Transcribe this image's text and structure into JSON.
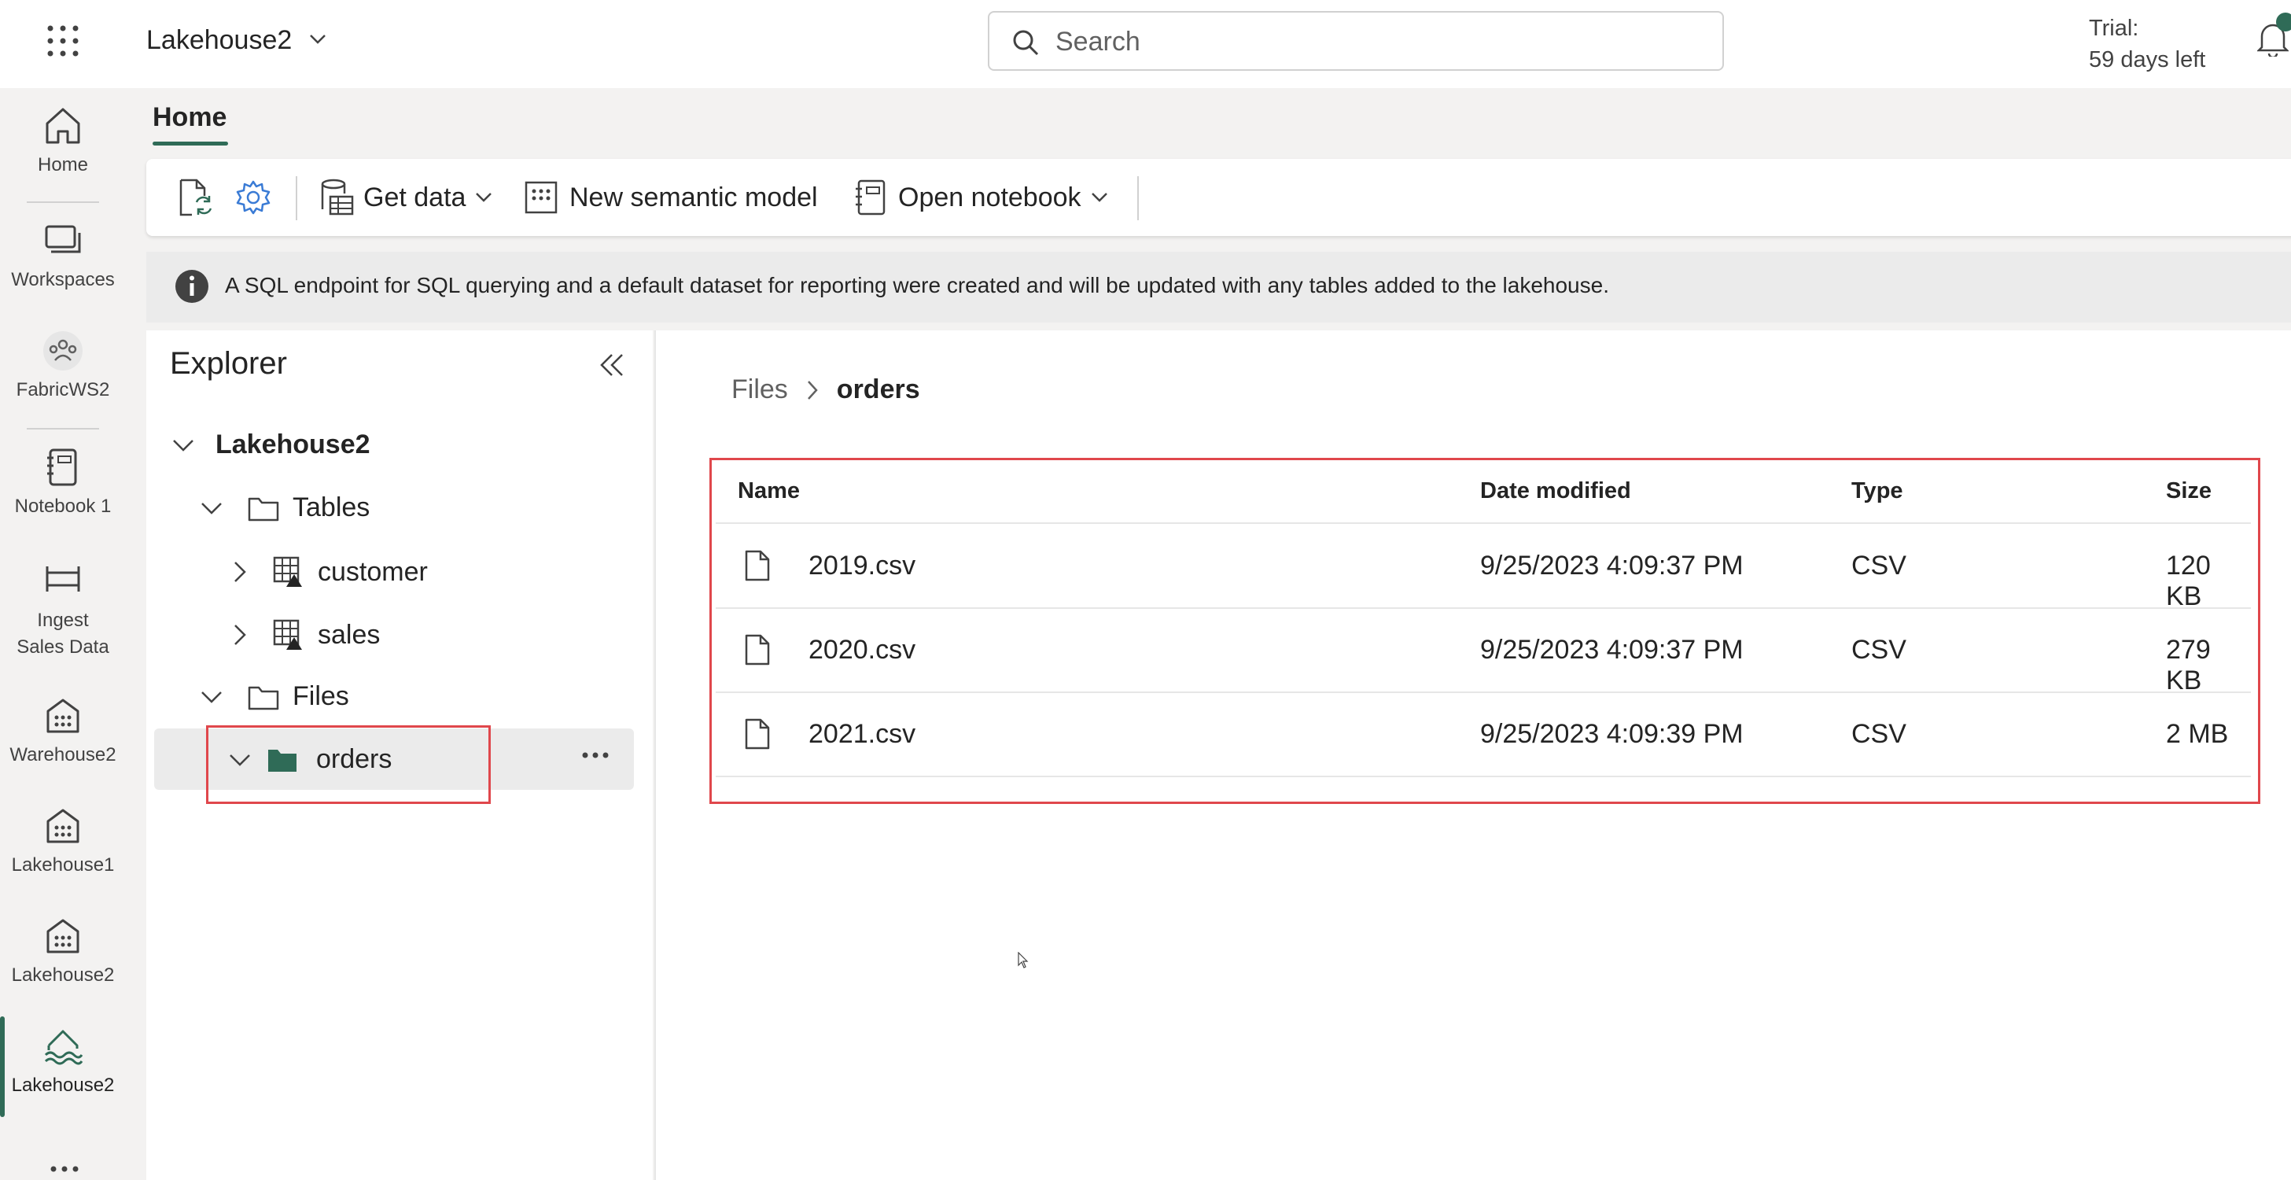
{
  "topbar": {
    "app_title": "Lakehouse2",
    "search_placeholder": "Search",
    "trial_line1": "Trial:",
    "trial_line2": "59 days left"
  },
  "rail": {
    "items": [
      {
        "label": "Home",
        "icon": "home-icon"
      },
      {
        "label": "Workspaces",
        "icon": "workspaces-icon"
      },
      {
        "label": "FabricWS2",
        "icon": "workspace-people-icon"
      },
      {
        "label": "Notebook 1",
        "icon": "notebook-icon"
      },
      {
        "label": "Ingest Sales Data",
        "icon": "pipeline-icon"
      },
      {
        "label": "Warehouse2",
        "icon": "warehouse-icon"
      },
      {
        "label": "Lakehouse1",
        "icon": "warehouse-icon"
      },
      {
        "label": "Lakehouse2",
        "icon": "warehouse-icon"
      },
      {
        "label": "Lakehouse2",
        "icon": "lakehouse-icon",
        "active": true
      }
    ]
  },
  "ribbon": {
    "tab": "Home",
    "get_data": "Get data",
    "new_semantic_model": "New semantic model",
    "open_notebook": "Open notebook"
  },
  "info_bar": {
    "text": "A SQL endpoint for SQL querying and a default dataset for reporting were created and will be updated with any tables added to the lakehouse."
  },
  "explorer": {
    "title": "Explorer",
    "root": "Lakehouse2",
    "tables_folder": "Tables",
    "tables": [
      "customer",
      "sales"
    ],
    "files_folder": "Files",
    "files_subfolder": "orders"
  },
  "content": {
    "breadcrumb": [
      "Files",
      "orders"
    ],
    "columns": [
      "Name",
      "Date modified",
      "Type",
      "Size"
    ],
    "rows": [
      {
        "name": "2019.csv",
        "modified": "9/25/2023 4:09:37 PM",
        "type": "CSV",
        "size": "120 KB"
      },
      {
        "name": "2020.csv",
        "modified": "9/25/2023 4:09:37 PM",
        "type": "CSV",
        "size": "279 KB"
      },
      {
        "name": "2021.csv",
        "modified": "9/25/2023 4:09:39 PM",
        "type": "CSV",
        "size": "2 MB"
      }
    ]
  },
  "colors": {
    "accent": "#2f6b57",
    "highlight_box": "#e0474c"
  }
}
